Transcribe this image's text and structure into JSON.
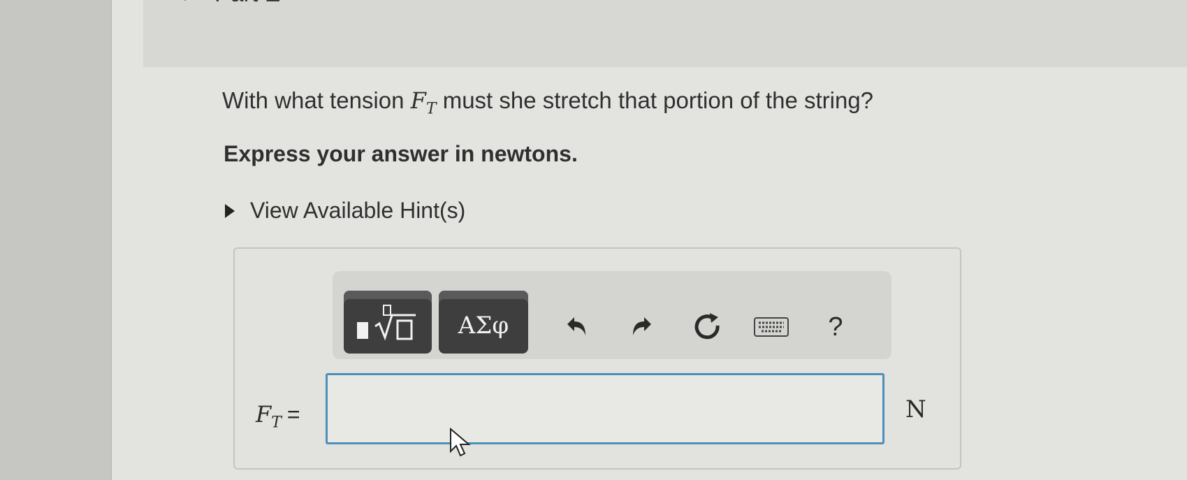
{
  "part_header": {
    "title": "Part E"
  },
  "question": {
    "prefix": "With what tension",
    "variable": "F",
    "variable_subscript": "T",
    "suffix": "must she stretch that portion of the string?"
  },
  "instruction": "Express your answer in newtons.",
  "hint_link": {
    "label": "View Available Hint(s)"
  },
  "toolbar": {
    "templates_icon": "templates-icon",
    "symbols_label": "ΑΣφ",
    "undo_icon": "undo-icon",
    "redo_icon": "redo-icon",
    "reset_icon": "reset-icon",
    "keyboard_icon": "keyboard-icon",
    "help_label": "?"
  },
  "answer": {
    "variable": "F",
    "variable_subscript": "T",
    "equals": "=",
    "value": "",
    "unit": "N"
  },
  "colors": {
    "input_border": "#4a90b8",
    "toolbar_button": "#3e3e3e"
  }
}
